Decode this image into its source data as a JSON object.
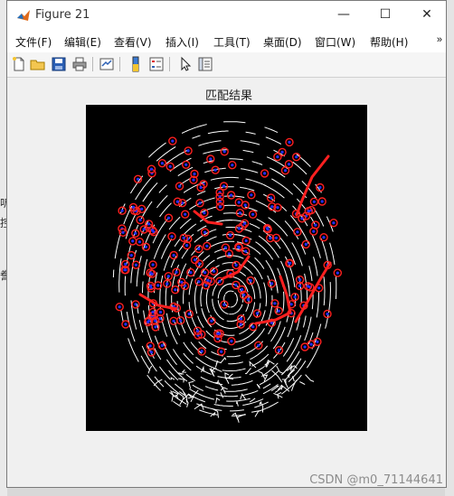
{
  "window": {
    "title": "Figure 21",
    "controls": {
      "minimize": "—",
      "maximize": "☐",
      "close": "✕"
    }
  },
  "menu": {
    "items": [
      "文件(F)",
      "编辑(E)",
      "查看(V)",
      "插入(I)",
      "工具(T)",
      "桌面(D)",
      "窗口(W)",
      "帮助(H)"
    ],
    "overflow": "»"
  },
  "toolbar": {
    "buttons": [
      "new-figure-icon",
      "open-folder-icon",
      "save-icon",
      "print-icon",
      "link-icon",
      "colorbar-icon",
      "legend-icon",
      "pointer-icon",
      "property-inspector-icon"
    ]
  },
  "figure": {
    "title": "匹配结果"
  },
  "background": {
    "left_glyphs": [
      "听",
      "控",
      "誊"
    ]
  },
  "watermark": "CSDN @m0_71144641",
  "colors": {
    "marker_red": "#ff2020",
    "marker_blue": "#2030ff",
    "ridge": "#ffffff",
    "axes_bg": "#000000"
  }
}
